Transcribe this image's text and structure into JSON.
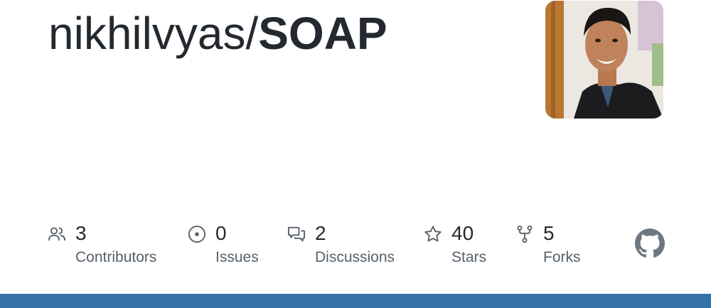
{
  "repo": {
    "owner": "nikhilvyas/",
    "name": "SOAP"
  },
  "avatar": {
    "description_icon": "avatar-photo"
  },
  "stats": [
    {
      "icon": "people-icon",
      "value": "3",
      "label": "Contributors"
    },
    {
      "icon": "issue-icon",
      "value": "0",
      "label": "Issues"
    },
    {
      "icon": "discussions-icon",
      "value": "2",
      "label": "Discussions"
    },
    {
      "icon": "star-icon",
      "value": "40",
      "label": "Stars"
    },
    {
      "icon": "fork-icon",
      "value": "5",
      "label": "Forks"
    }
  ],
  "logo": {
    "icon": "github-logo-icon"
  },
  "colors": {
    "text": "#24292f",
    "muted": "#57606a",
    "bottom_bar": "#3572a5"
  }
}
